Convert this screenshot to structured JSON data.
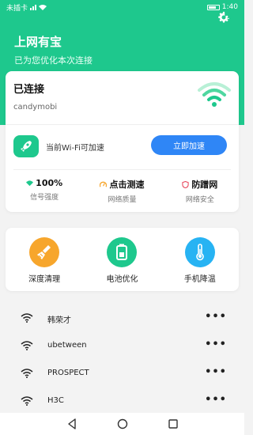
{
  "status_bar": {
    "carrier": "未插卡",
    "time": "1:40"
  },
  "header": {
    "title": "上网有宝",
    "subtitle": "已为您优化本次连接",
    "settings_icon": "gear-icon"
  },
  "connection": {
    "status": "已连接",
    "ssid": "candymobi",
    "accel_text": "当前Wi-Fi可加速",
    "accel_button": "立即加速"
  },
  "stats": [
    {
      "value": "100%",
      "label": "信号强度",
      "icon": "wifi-icon"
    },
    {
      "value": "点击测速",
      "label": "网络质量",
      "icon": "speed-icon"
    },
    {
      "value": "防蹭网",
      "label": "网络安全",
      "icon": "shield-icon"
    }
  ],
  "tools": [
    {
      "label": "深度清理",
      "icon": "broom-icon",
      "color": "#f7a62c"
    },
    {
      "label": "电池优化",
      "icon": "battery-icon",
      "color": "#1ec88d"
    },
    {
      "label": "手机降温",
      "icon": "thermometer-icon",
      "color": "#27b3f3"
    }
  ],
  "wifi_networks": [
    {
      "ssid": "韩荣才"
    },
    {
      "ssid": "ubetween"
    },
    {
      "ssid": "PROSPECT"
    },
    {
      "ssid": "H3C"
    }
  ],
  "colors": {
    "brand": "#1ec88d",
    "button": "#2f86f6"
  }
}
